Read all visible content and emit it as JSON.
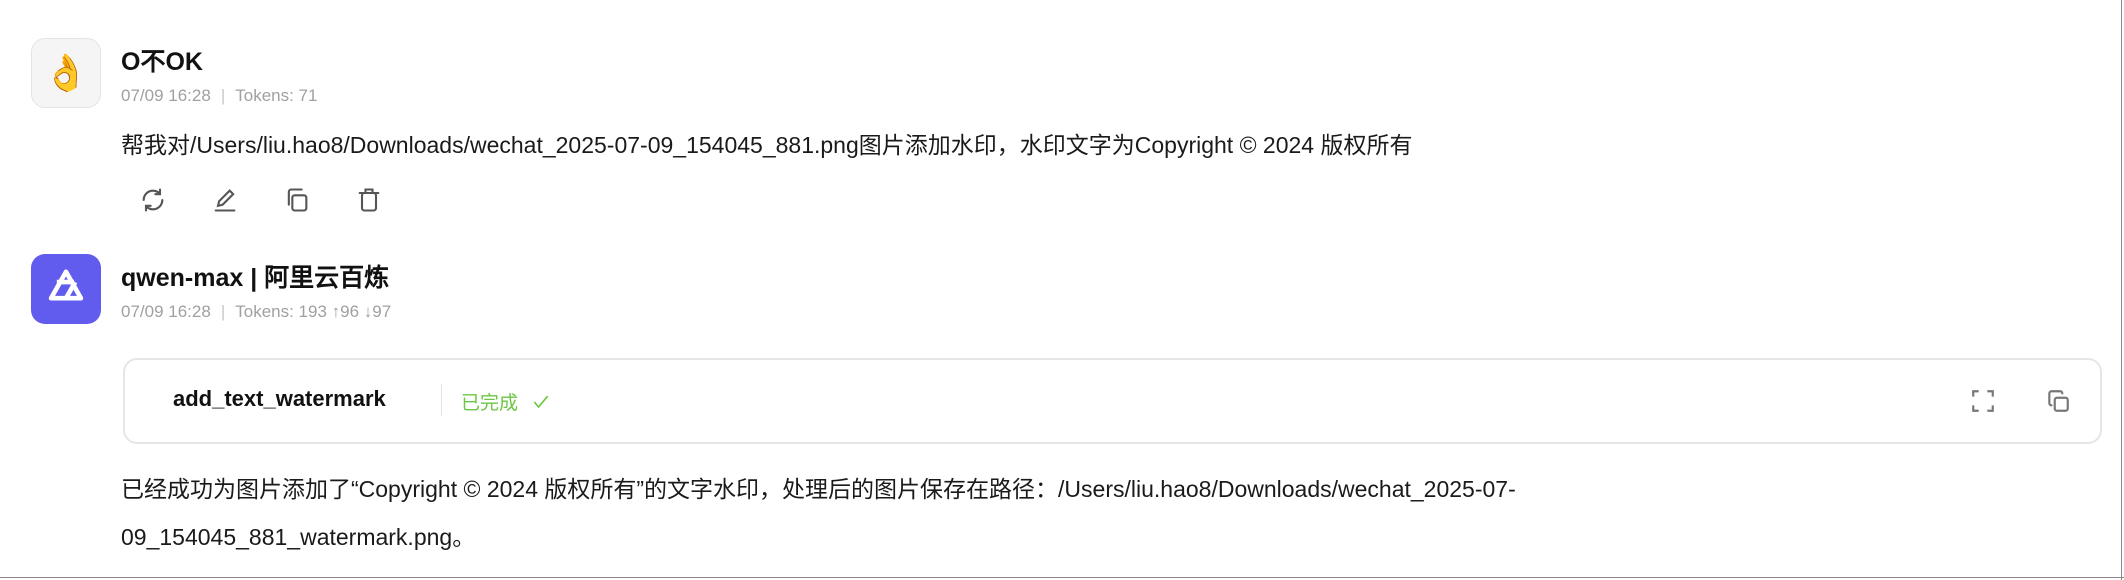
{
  "user_message": {
    "avatar_emoji": "👌",
    "name": "O不OK",
    "time": "07/09 16:28",
    "tokens": "Tokens: 71",
    "text": "帮我对/Users/liu.hao8/Downloads/wechat_2025-07-09_154045_881.png图片添加水印，水印文字为Copyright © 2024 版权所有",
    "actions": [
      "refresh-icon",
      "edit-icon",
      "copy-icon",
      "delete-icon"
    ]
  },
  "assistant_message": {
    "avatar_icon": "qwen-logo-icon",
    "avatar_color": "#615ced",
    "name": "qwen-max | 阿里云百炼",
    "time": "07/09 16:28",
    "tokens": "Tokens: 193 ↑96 ↓97",
    "tool_call": {
      "name": "add_text_watermark",
      "status": "已完成",
      "status_icon": "check-icon",
      "status_color": "#6cc644",
      "actions": [
        "fullscreen-icon",
        "copy-icon"
      ]
    },
    "line1": "已经成功为图片添加了“Copyright © 2024 版权所有”的文字水印，处理后的图片保存在路径：/Users/liu.hao8/Downloads/wechat_2025-07-",
    "line2": "09_154045_881_watermark.png。"
  }
}
